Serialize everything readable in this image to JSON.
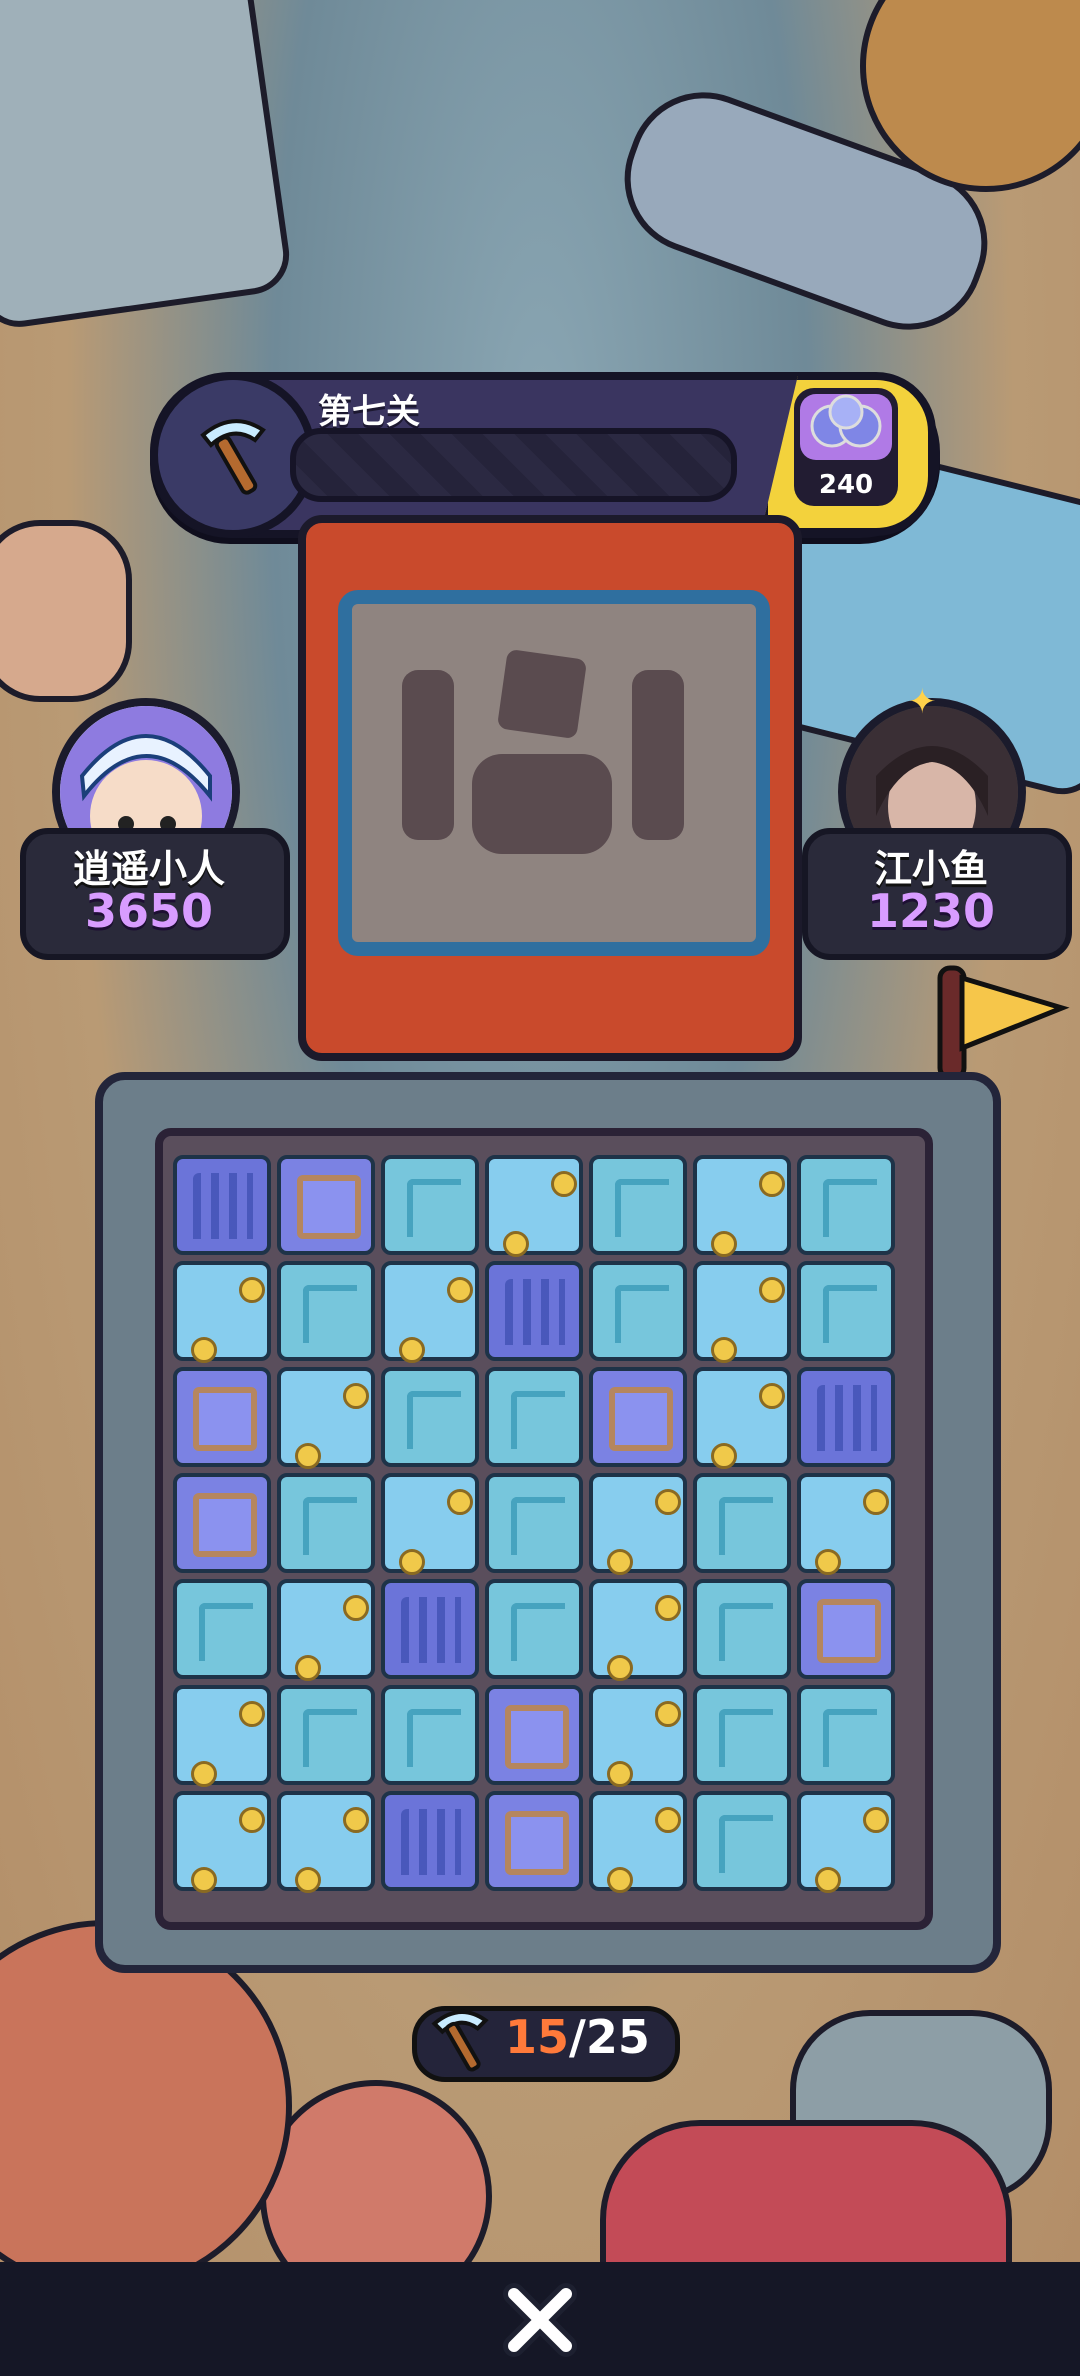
{
  "hud": {
    "level_title": "第七关",
    "reward_count": "240",
    "reward_icon": "gem-orbs-icon",
    "tool_icon": "pickaxe-icon",
    "progress": 0.0
  },
  "players": {
    "left": {
      "name": "逍遥小人",
      "score": "3650",
      "avatar_icon": "boy-cap-avatar"
    },
    "right": {
      "name": "江小鱼",
      "score": "1230",
      "avatar_icon": "girl-avatar"
    }
  },
  "board": {
    "rows": [
      [
        "bars",
        "purple",
        "cyan",
        "blue",
        "cyan",
        "blue",
        "cyan"
      ],
      [
        "blue",
        "cyan",
        "blue",
        "bars",
        "cyan",
        "blue",
        "cyan"
      ],
      [
        "purple",
        "blue",
        "cyan",
        "cyan",
        "purple",
        "blue",
        "bars"
      ],
      [
        "purple",
        "cyan",
        "blue",
        "cyan",
        "blue",
        "cyan",
        "blue"
      ],
      [
        "cyan",
        "blue",
        "bars",
        "cyan",
        "blue",
        "cyan",
        "purple"
      ],
      [
        "blue",
        "cyan",
        "cyan",
        "purple",
        "blue",
        "cyan",
        "cyan"
      ],
      [
        "blue",
        "blue",
        "bars",
        "purple",
        "blue",
        "cyan",
        "blue"
      ]
    ]
  },
  "pick_counter": {
    "current": "15",
    "separator": "/",
    "total": "25"
  },
  "bottom": {
    "close_icon": "close-x-icon"
  },
  "colors": {
    "hud_bg": "#3a3560",
    "reward_bg": "#f3d23c",
    "score_color": "#d89cff",
    "current_pick": "#ff7a3a"
  }
}
